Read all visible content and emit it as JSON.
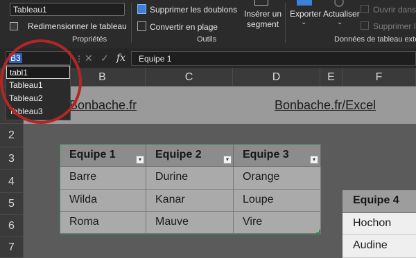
{
  "ribbon": {
    "table_name_value": "Tableau1",
    "resize_table_label": "Redimensionner le tableau",
    "remove_duplicates_label": "Supprimer les doublons",
    "convert_to_range_label": "Convertir en plage",
    "insert_slicer_line1": "Insérer un",
    "insert_slicer_line2": "segment",
    "export_label": "Exporter",
    "refresh_label": "Actualiser",
    "open_in_browser_label": "Ouvrir dans l",
    "unlink_label": "Supprimer la",
    "group_properties": "Propriétés",
    "group_tools": "Outils",
    "group_external_data": "Données de tableau externe"
  },
  "formula_bar": {
    "name_box_value": "B3",
    "formula_value": "Equipe 1",
    "cancel_glyph": "✕",
    "enter_glyph": "✓",
    "fx_glyph": "fx"
  },
  "name_dropdown": {
    "items": [
      "tabl1",
      "Tableau1",
      "Tableau2",
      "Tableau3"
    ]
  },
  "columns": [
    "B",
    "C",
    "D",
    "E",
    "F"
  ],
  "rows": [
    "2",
    "3",
    "4",
    "5",
    "6",
    "7"
  ],
  "links": {
    "left": "Bonbache.fr",
    "right": "Bonbache.fr/Excel"
  },
  "table1": {
    "headers": [
      "Equipe 1",
      "Equipe 2",
      "Equipe 3"
    ],
    "rows": [
      [
        "Barre",
        "Durine",
        "Orange"
      ],
      [
        "Wilda",
        "Kanar",
        "Loupe"
      ],
      [
        "Roma",
        "Mauve",
        "Vire"
      ]
    ],
    "filter_glyph": "▾"
  },
  "table2": {
    "header": "Equipe 4",
    "rows": [
      "Hochon",
      "Audine"
    ]
  },
  "colors": {
    "highlight_circle": "#b42626",
    "selection_blue": "#2f62b8",
    "table_border": "#2e8b57"
  }
}
